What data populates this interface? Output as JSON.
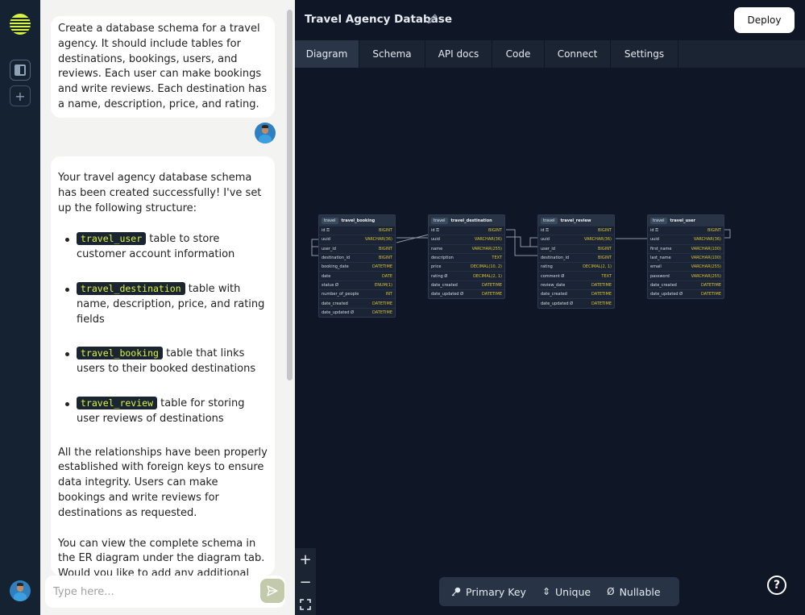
{
  "rail": {
    "logo_icon": "logo-icon",
    "toggle_sidebar_icon": "sidebar-icon",
    "add_icon": "plus-icon"
  },
  "chat": {
    "user_message": "Create a database schema for a travel agency. It should include tables for destinations, bookings, users, and reviews. Each user can make bookings and write reviews. Each destination has a name, description, price, and rating.",
    "bot_intro": "Your travel agency database schema has been created successfully! I've set up the following structure:",
    "bullets": [
      {
        "code": "travel_user",
        "text": " table to store customer account information"
      },
      {
        "code": "travel_destination",
        "text": " table with name, description, price, and rating fields"
      },
      {
        "code": "travel_booking",
        "text": " table that links users to their booked destinations"
      },
      {
        "code": "travel_review",
        "text": " table for storing user reviews of destinations"
      }
    ],
    "bot_p2": "All the relationships have been properly established with foreign keys to ensure data integrity. Users can make bookings and write reviews for destinations as requested.",
    "bot_p3": "You can view the complete schema in the ER diagram under the diagram tab. Would you like to add any additional tables or",
    "input_placeholder": "Type here..."
  },
  "header": {
    "title": "Travel Agency Database",
    "deploy_label": "Deploy"
  },
  "tabs": [
    {
      "label": "Diagram",
      "active": true
    },
    {
      "label": "Schema",
      "active": false
    },
    {
      "label": "API docs",
      "active": false
    },
    {
      "label": "Code",
      "active": false
    },
    {
      "label": "Connect",
      "active": false
    },
    {
      "label": "Settings",
      "active": false
    }
  ],
  "tables": [
    {
      "schema": "travel",
      "name": "travel_booking",
      "columns": [
        {
          "name": "id",
          "flag": "key",
          "type": "BIGINT"
        },
        {
          "name": "uuid",
          "flag": "",
          "type": "VARCHAR(36)"
        },
        {
          "name": "user_id",
          "flag": "",
          "type": "BIGINT"
        },
        {
          "name": "destination_id",
          "flag": "",
          "type": "BIGINT"
        },
        {
          "name": "booking_date",
          "flag": "",
          "type": "DATETIME"
        },
        {
          "name": "date",
          "flag": "",
          "type": "DATE"
        },
        {
          "name": "status",
          "flag": "nullable",
          "type": "ENUM(1)"
        },
        {
          "name": "number_of_people",
          "flag": "",
          "type": "INT"
        },
        {
          "name": "date_created",
          "flag": "",
          "type": "DATETIME"
        },
        {
          "name": "date_updated",
          "flag": "nullable",
          "type": "DATETIME"
        }
      ]
    },
    {
      "schema": "travel",
      "name": "travel_destination",
      "columns": [
        {
          "name": "id",
          "flag": "key",
          "type": "BIGINT"
        },
        {
          "name": "uuid",
          "flag": "",
          "type": "VARCHAR(36)"
        },
        {
          "name": "name",
          "flag": "",
          "type": "VARCHAR(255)"
        },
        {
          "name": "description",
          "flag": "",
          "type": "TEXT"
        },
        {
          "name": "price",
          "flag": "",
          "type": "DECIMAL(10, 2)"
        },
        {
          "name": "rating",
          "flag": "nullable",
          "type": "DECIMAL(2, 1)"
        },
        {
          "name": "date_created",
          "flag": "",
          "type": "DATETIME"
        },
        {
          "name": "date_updated",
          "flag": "nullable",
          "type": "DATETIME"
        }
      ]
    },
    {
      "schema": "travel",
      "name": "travel_review",
      "columns": [
        {
          "name": "id",
          "flag": "key",
          "type": "BIGINT"
        },
        {
          "name": "uuid",
          "flag": "",
          "type": "VARCHAR(36)"
        },
        {
          "name": "user_id",
          "flag": "",
          "type": "BIGINT"
        },
        {
          "name": "destination_id",
          "flag": "",
          "type": "BIGINT"
        },
        {
          "name": "rating",
          "flag": "",
          "type": "DECIMAL(2, 1)"
        },
        {
          "name": "comment",
          "flag": "nullable",
          "type": "TEXT"
        },
        {
          "name": "review_date",
          "flag": "",
          "type": "DATETIME"
        },
        {
          "name": "date_created",
          "flag": "",
          "type": "DATETIME"
        },
        {
          "name": "date_updated",
          "flag": "nullable",
          "type": "DATETIME"
        }
      ]
    },
    {
      "schema": "travel",
      "name": "travel_user",
      "columns": [
        {
          "name": "id",
          "flag": "key",
          "type": "BIGINT"
        },
        {
          "name": "uuid",
          "flag": "",
          "type": "VARCHAR(36)"
        },
        {
          "name": "first_name",
          "flag": "",
          "type": "VARCHAR(100)"
        },
        {
          "name": "last_name",
          "flag": "",
          "type": "VARCHAR(100)"
        },
        {
          "name": "email",
          "flag": "",
          "type": "VARCHAR(255)"
        },
        {
          "name": "password",
          "flag": "",
          "type": "VARCHAR(255)"
        },
        {
          "name": "date_created",
          "flag": "",
          "type": "DATETIME"
        },
        {
          "name": "date_updated",
          "flag": "nullable",
          "type": "DATETIME"
        }
      ]
    }
  ],
  "zoom_controls": {
    "zoom_in": "+",
    "zoom_out": "−",
    "fit_icon": "fullscreen-icon"
  },
  "legend": [
    {
      "icon": "key-icon",
      "glyph": "🔑",
      "label": "Primary Key"
    },
    {
      "icon": "unique-icon",
      "glyph": "⇕",
      "label": "Unique"
    },
    {
      "icon": "nullable-icon",
      "glyph": "Ø",
      "label": "Nullable"
    }
  ],
  "help_label": "?",
  "colors": {
    "accent": "#d9f542",
    "canvas_bg": "#0f1625",
    "type_color": "#d7c23a"
  }
}
